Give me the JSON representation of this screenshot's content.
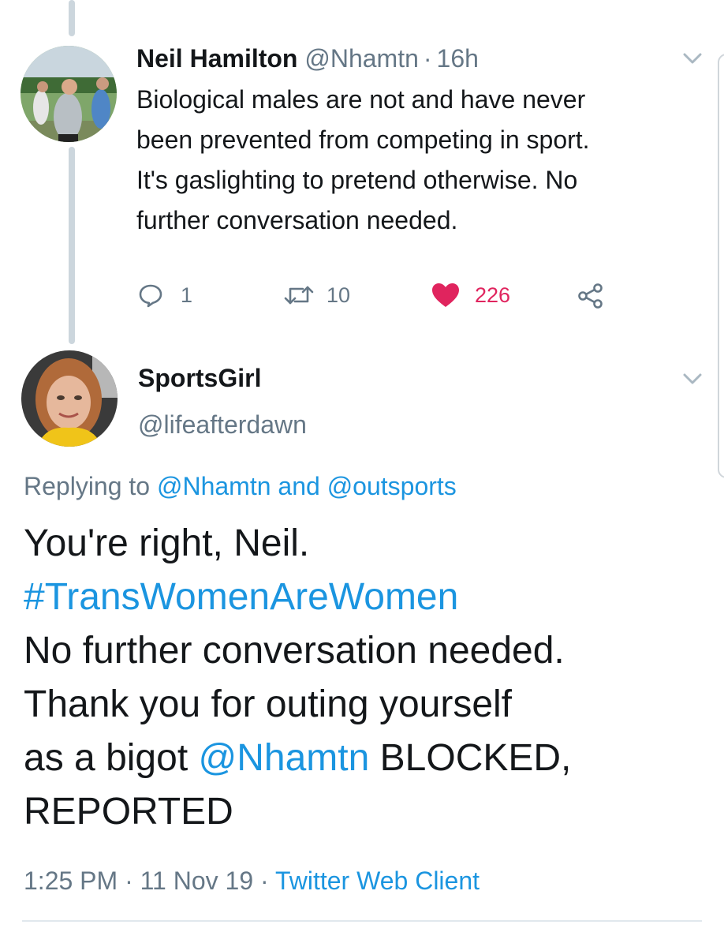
{
  "tweet1": {
    "name": "Neil Hamilton",
    "handle": "@Nhamtn",
    "sep": "·",
    "time": "16h",
    "lines": [
      "Biological males are not and have never",
      "been prevented from competing in sport.",
      "It's gaslighting to pretend otherwise. No",
      "further conversation needed."
    ],
    "replies": "1",
    "retweets": "10",
    "likes": "226",
    "like_color": "#e0245e"
  },
  "tweet2": {
    "name": "SportsGirl",
    "handle": "@lifeafterdawn",
    "replying_prefix": "Replying to",
    "replying_user1": "@Nhamtn",
    "replying_and": "and",
    "replying_user2": "@outsports",
    "line1": "You're right, Neil.",
    "hashtag": "#TransWomenAreWomen",
    "line3": "No further conversation needed.",
    "line4": "Thank you for outing yourself",
    "line5_prefix": "as a bigot",
    "line5_mention": "@Nhamtn",
    "line5_suffix": "BLOCKED,",
    "line6": "REPORTED",
    "time": "1:25 PM",
    "sep1": "·",
    "date": "11 Nov 19",
    "sep2": "·",
    "client": "Twitter Web Client",
    "link_color": "#1b95e0"
  }
}
